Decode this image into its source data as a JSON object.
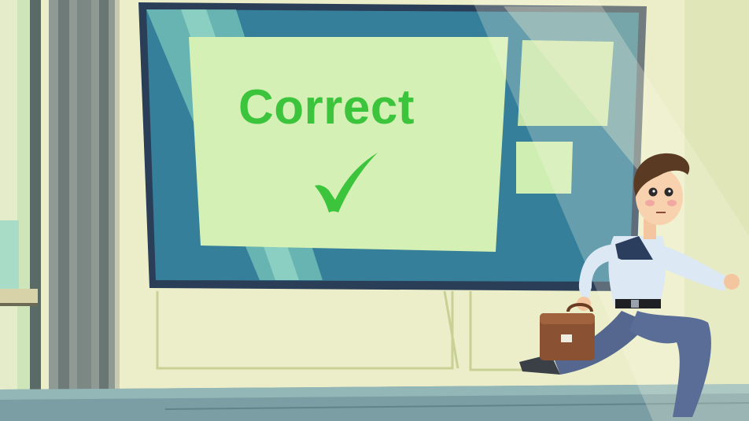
{
  "result": {
    "text": "Correct",
    "status": "correct",
    "icon": "checkmark-icon"
  },
  "colors": {
    "wall": "#e8ecc4",
    "window_frame": "#4a5a63",
    "screen_bezel": "#2b3e57",
    "screen": "#357f9a",
    "panel": "#d4f0b4",
    "success_green": "#3cc43c",
    "floor": "#7a9ea3"
  }
}
